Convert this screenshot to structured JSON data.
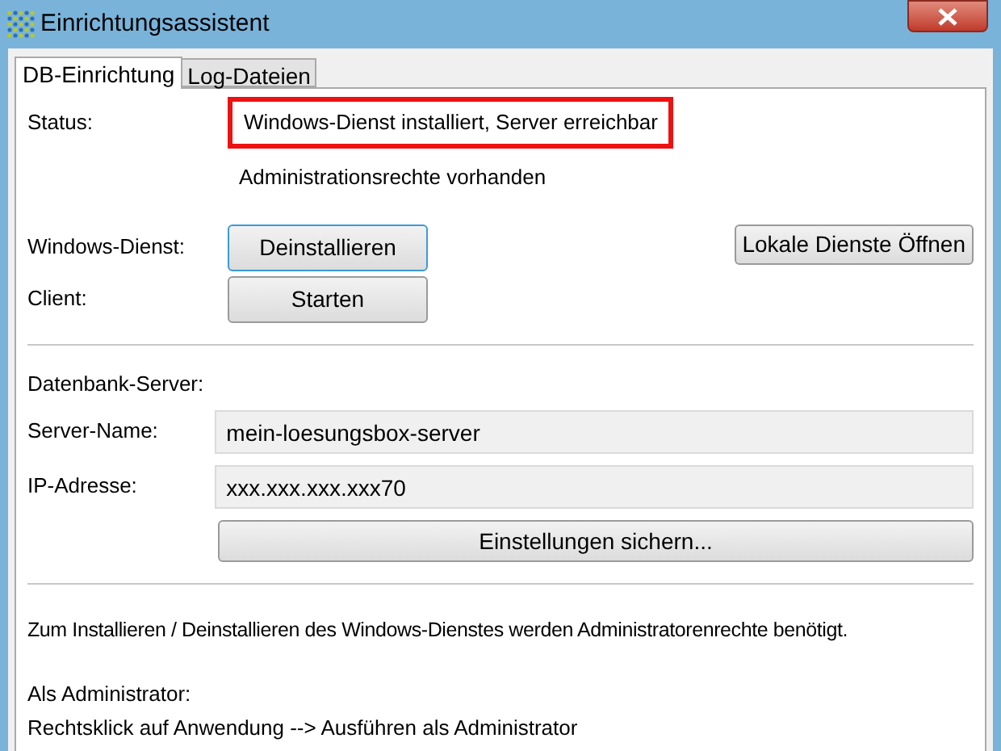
{
  "window": {
    "title": "Einrichtungsassistent"
  },
  "tabs": [
    {
      "label": "DB-Einrichtung",
      "selected": true
    },
    {
      "label": "Log-Dateien",
      "selected": false
    }
  ],
  "status": {
    "label": "Status:",
    "value": "Windows-Dienst installiert, Server erreichbar",
    "highlighted": true,
    "note": "Administrationsrechte vorhanden"
  },
  "service_rows": [
    {
      "label": "Windows-Dienst:",
      "button": "Deinstallieren",
      "focused": true
    },
    {
      "label": "Client:",
      "button": "Starten",
      "focused": false
    }
  ],
  "open_services_button": "Lokale Dienste Öffnen",
  "db_server": {
    "heading": "Datenbank-Server:",
    "fields": [
      {
        "label": "Server-Name:",
        "value": "mein-loesungsbox-server"
      },
      {
        "label": "IP-Adresse:",
        "value": "xxx.xxx.xxx.xxx70"
      }
    ],
    "save_button": "Einstellungen sichern..."
  },
  "info": [
    "Zum Installieren / Deinstallieren des Windows-Dienstes werden Administratorenrechte benötigt.",
    "Als Administrator:",
    "Rechtsklick auf Anwendung --> Ausführen als Administrator"
  ]
}
